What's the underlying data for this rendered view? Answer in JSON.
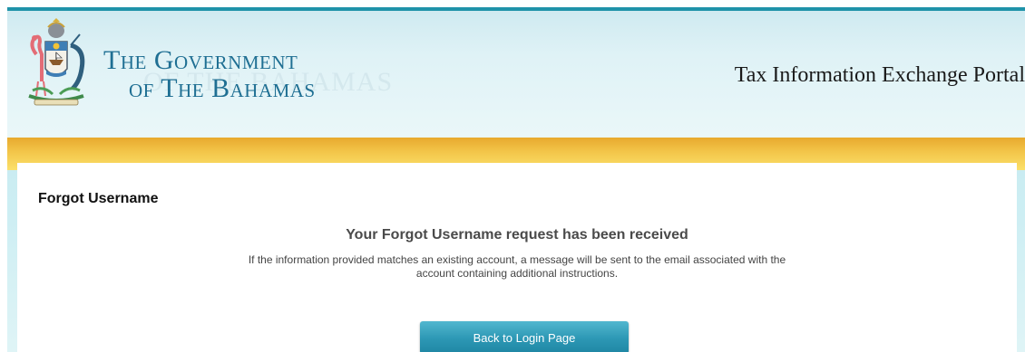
{
  "header": {
    "gov_line1": "The Government",
    "gov_line2": "of The Bahamas",
    "watermark": "OF THE BAHAMAS",
    "portal_title": "Tax Information Exchange Portal",
    "crest_icon": "bahamas-coat-of-arms"
  },
  "main": {
    "section_title": "Forgot Username",
    "message_heading": "Your Forgot Username request has been received",
    "message_body": "If the information provided matches an existing account, a message will be sent to the email associated with the account containing additional instructions.",
    "back_button_label": "Back to Login Page"
  },
  "colors": {
    "accent_teal": "#1f93a9",
    "gold_band": "#f3c64a",
    "title_blue": "#1f6f93",
    "button": "#2c97b4"
  }
}
